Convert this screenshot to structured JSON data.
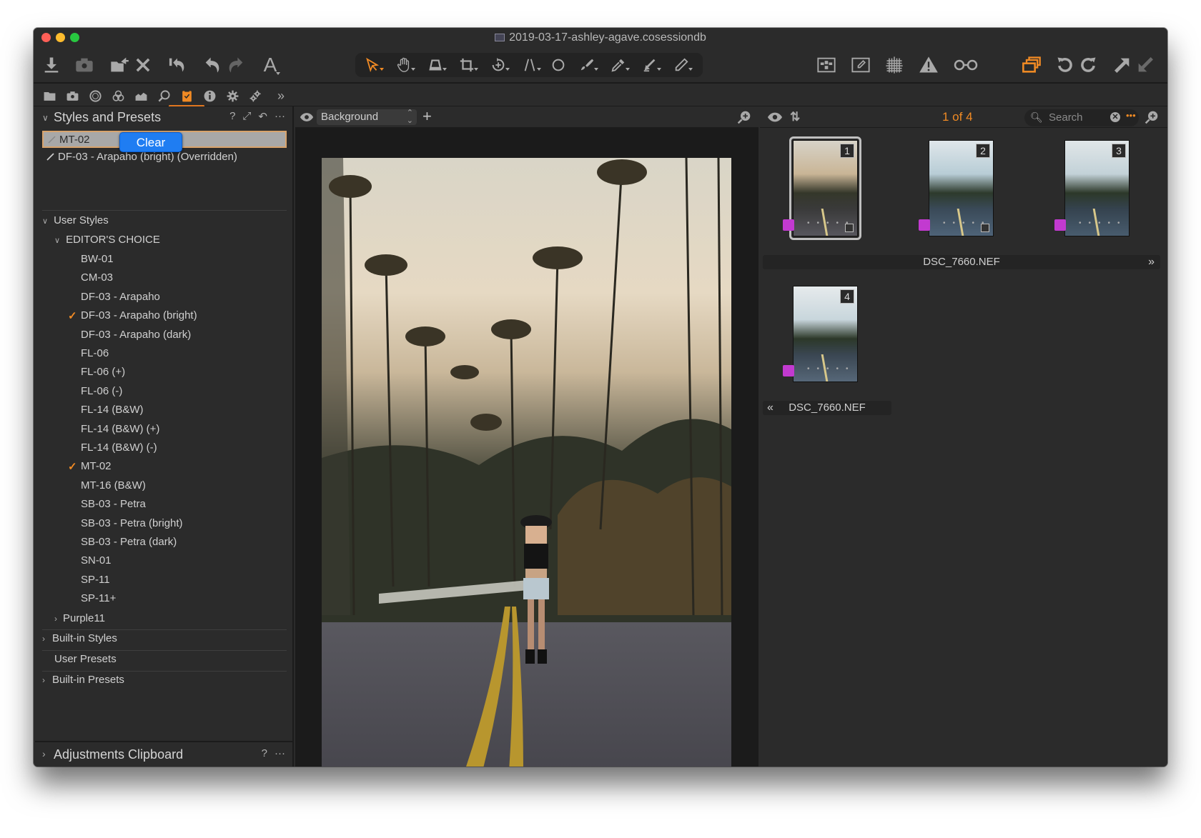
{
  "window": {
    "title": "2019-03-17-ashley-agave.cosessiondb"
  },
  "toolbar": {
    "left_icons": [
      "import-icon",
      "camera-icon",
      "export-icon",
      "delete-icon",
      "reset-icon",
      "undo-icon",
      "redo-icon",
      "text-icon"
    ],
    "tools": [
      "cursor-select-tool",
      "pan-tool",
      "keystone-tool",
      "crop-tool",
      "rotate-tool",
      "straighten-tool",
      "circle-tool",
      "brush-tool",
      "picker-tool",
      "eraser-tool",
      "pencil-tool"
    ],
    "right_icons": [
      "grid-view-icon",
      "edit-view-icon",
      "overlay-grid-icon",
      "exposure-warning-icon",
      "proof-glasses-icon",
      "stack-variants-icon",
      "rotate-left-icon",
      "rotate-right-icon",
      "copy-adjustments-icon",
      "apply-adjustments-icon"
    ],
    "colors": {
      "accent": "#f08a24",
      "active_tool": "#f08a24"
    }
  },
  "tool_tabs": {
    "items": [
      "library",
      "capture",
      "lens",
      "color",
      "exposure",
      "details",
      "adjustments",
      "metadata",
      "output",
      "batch"
    ],
    "active": "adjustments",
    "more_label": "»"
  },
  "styles_panel": {
    "title": "Styles and Presets",
    "help": "?",
    "more": "···",
    "applied": [
      {
        "label": "MT-02",
        "selected": true
      },
      {
        "label": "DF-03 - Arapaho (bright) (Overridden)",
        "selected": false
      }
    ],
    "popup_button": "Clear",
    "user_styles_label": "User Styles",
    "editors_choice_label": "EDITOR'S CHOICE",
    "editors_choice_items": [
      {
        "label": "BW-01",
        "checked": false
      },
      {
        "label": "CM-03",
        "checked": false
      },
      {
        "label": "DF-03 - Arapaho",
        "checked": false
      },
      {
        "label": "DF-03 - Arapaho (bright)",
        "checked": true
      },
      {
        "label": "DF-03 - Arapaho (dark)",
        "checked": false
      },
      {
        "label": "FL-06",
        "checked": false
      },
      {
        "label": "FL-06 (+)",
        "checked": false
      },
      {
        "label": "FL-06 (-)",
        "checked": false
      },
      {
        "label": "FL-14 (B&W)",
        "checked": false
      },
      {
        "label": "FL-14 (B&W) (+)",
        "checked": false
      },
      {
        "label": "FL-14 (B&W) (-)",
        "checked": false
      },
      {
        "label": "MT-02",
        "checked": true
      },
      {
        "label": "MT-16 (B&W)",
        "checked": false
      },
      {
        "label": "SB-03 - Petra",
        "checked": false
      },
      {
        "label": "SB-03 - Petra (bright)",
        "checked": false
      },
      {
        "label": "SB-03 - Petra (dark)",
        "checked": false
      },
      {
        "label": "SN-01",
        "checked": false
      },
      {
        "label": "SP-11",
        "checked": false
      },
      {
        "label": "SP-11+",
        "checked": false
      }
    ],
    "purple_group": "Purple11",
    "builtin_styles": "Built-in Styles",
    "user_presets": "User Presets",
    "builtin_presets": "Built-in Presets"
  },
  "clipboard_panel": {
    "title": "Adjustments Clipboard",
    "help": "?",
    "more": "···"
  },
  "viewer": {
    "layer_select": "Background",
    "add_layer": "+"
  },
  "browser": {
    "counter": "1 of 4",
    "search_placeholder": "Search",
    "thumbnails": [
      {
        "index": "1",
        "selected": true,
        "color_tag": "#c23ad0",
        "rating": 0
      },
      {
        "index": "2",
        "selected": false,
        "color_tag": "#c23ad0",
        "rating": 0
      },
      {
        "index": "3",
        "selected": false,
        "color_tag": "#c23ad0",
        "rating": 0
      },
      {
        "index": "4",
        "selected": false,
        "color_tag": "#c23ad0",
        "rating": 0
      }
    ],
    "row1_filename": "DSC_7660.NEF",
    "row2_filename": "DSC_7660.NEF",
    "next_label": "»",
    "prev_label": "«"
  }
}
